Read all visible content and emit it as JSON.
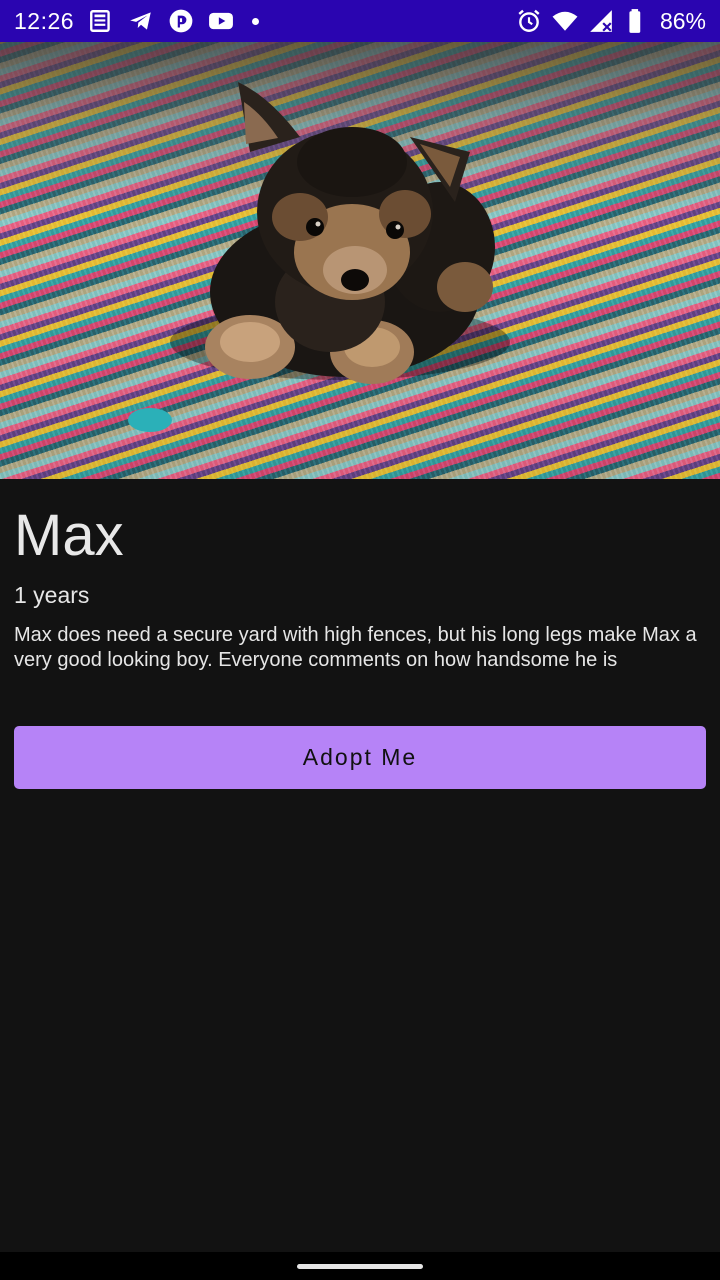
{
  "status_bar": {
    "time": "12:26",
    "battery": "86%",
    "left_icons": [
      "news-icon",
      "telegram-icon",
      "pocket-casts-icon",
      "youtube-icon",
      "notification-dot-icon"
    ],
    "right_icons": [
      "alarm-icon",
      "wifi-icon",
      "signal-icon",
      "battery-icon"
    ],
    "background": "#2a05b0"
  },
  "hero": {
    "image": "puppy-photo"
  },
  "pet": {
    "name": "Max",
    "age": "1 years",
    "description": "Max does need a secure yard with high fences, but his long legs make Max a very good looking boy. Everyone comments on how handsome he is"
  },
  "actions": {
    "adopt_label": "Adopt Me",
    "adopt_color": "#b683f7"
  },
  "theme": {
    "background": "#121212"
  }
}
